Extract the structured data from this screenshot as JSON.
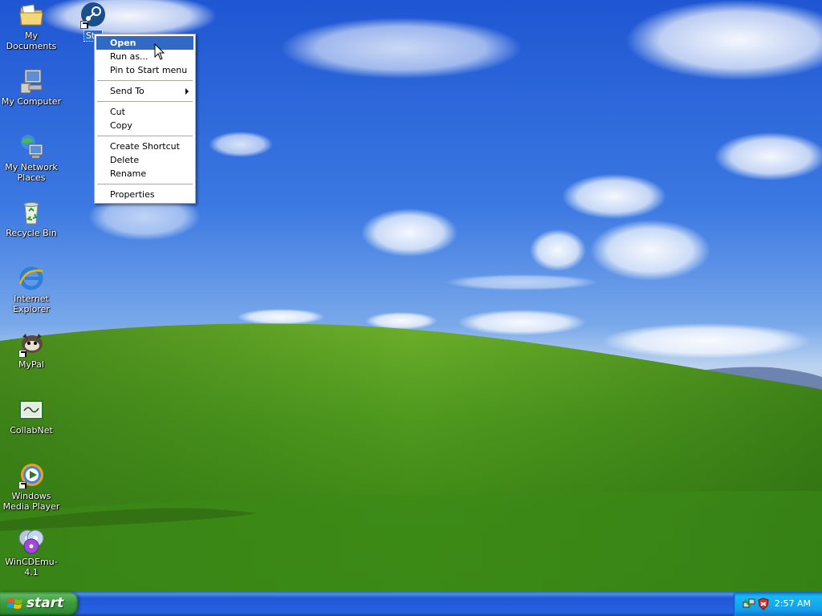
{
  "desktop": {
    "icons": [
      {
        "label": "My Documents",
        "icon": "folder-documents-icon"
      },
      {
        "label": "Ste",
        "icon": "steam-icon"
      },
      {
        "label": "My Computer",
        "icon": "computer-icon"
      },
      {
        "label": "My Network Places",
        "icon": "network-icon"
      },
      {
        "label": "Recycle Bin",
        "icon": "recycle-bin-icon"
      },
      {
        "label": "Internet Explorer",
        "icon": "internet-explorer-icon"
      },
      {
        "label": "MyPal",
        "icon": "mypal-icon"
      },
      {
        "label": "CollabNet",
        "icon": "collabnet-icon"
      },
      {
        "label": "Windows Media Player",
        "icon": "media-player-icon"
      },
      {
        "label": "WinCDEmu-4.1",
        "icon": "wincdemu-icon"
      }
    ]
  },
  "context_menu": {
    "items": [
      {
        "label": "Open"
      },
      {
        "label": "Run as..."
      },
      {
        "label": "Pin to Start menu"
      },
      {
        "label": "Send To"
      },
      {
        "label": "Cut"
      },
      {
        "label": "Copy"
      },
      {
        "label": "Create Shortcut"
      },
      {
        "label": "Delete"
      },
      {
        "label": "Rename"
      },
      {
        "label": "Properties"
      }
    ]
  },
  "taskbar": {
    "start_label": "start",
    "clock": "2:57 AM"
  },
  "colors": {
    "selection": "#316ac5",
    "taskbar": "#2663e0",
    "start": "#3d9b3d",
    "tray": "#139ee9"
  }
}
